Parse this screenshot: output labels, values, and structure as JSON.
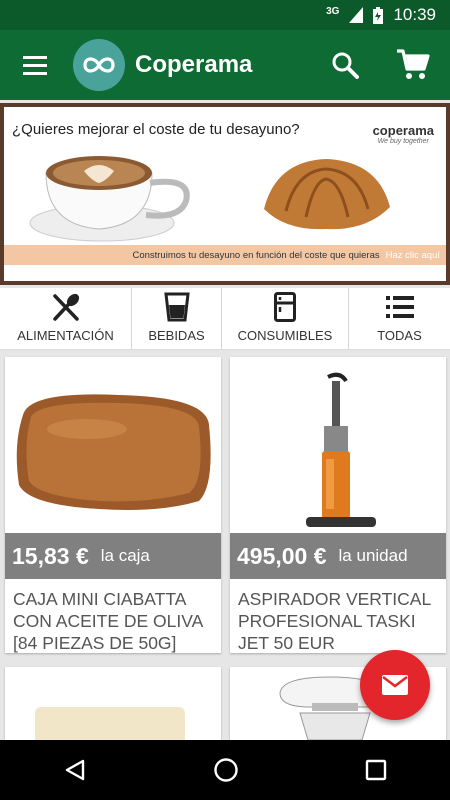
{
  "status": {
    "network": "3G",
    "time": "10:39"
  },
  "app_bar": {
    "title": "Coperama"
  },
  "banner": {
    "question": "¿Quieres mejorar el coste de tu desayuno?",
    "brand": "coperama",
    "tagline": "We buy together",
    "subtitle": "Construimos tu desayuno en función del coste que quieras",
    "cta": "Haz clic aquí"
  },
  "categories": [
    {
      "label": "ALIMENTACIÓN",
      "icon": "fork-knife-icon"
    },
    {
      "label": "BEBIDAS",
      "icon": "glass-icon"
    },
    {
      "label": "CONSUMIBLES",
      "icon": "fridge-icon"
    },
    {
      "label": "TODAS",
      "icon": "list-icon"
    }
  ],
  "products": [
    {
      "price": "15,83 €",
      "unit": "la caja",
      "name": "CAJA MINI CIABATTA CON ACEITE DE OLIVA [84 PIEZAS DE 50G]"
    },
    {
      "price": "495,00 €",
      "unit": "la unidad",
      "name": "ASPIRADOR VERTICAL PROFESIONAL TASKI JET 50 EUR"
    },
    {
      "price": "",
      "unit": "",
      "name": ""
    },
    {
      "price": "",
      "unit": "",
      "name": ""
    }
  ],
  "colors": {
    "status_bar": "#0c5a2a",
    "app_bar": "#0e6b34",
    "fab": "#e3262b",
    "price_overlay": "#6e6e6e"
  }
}
